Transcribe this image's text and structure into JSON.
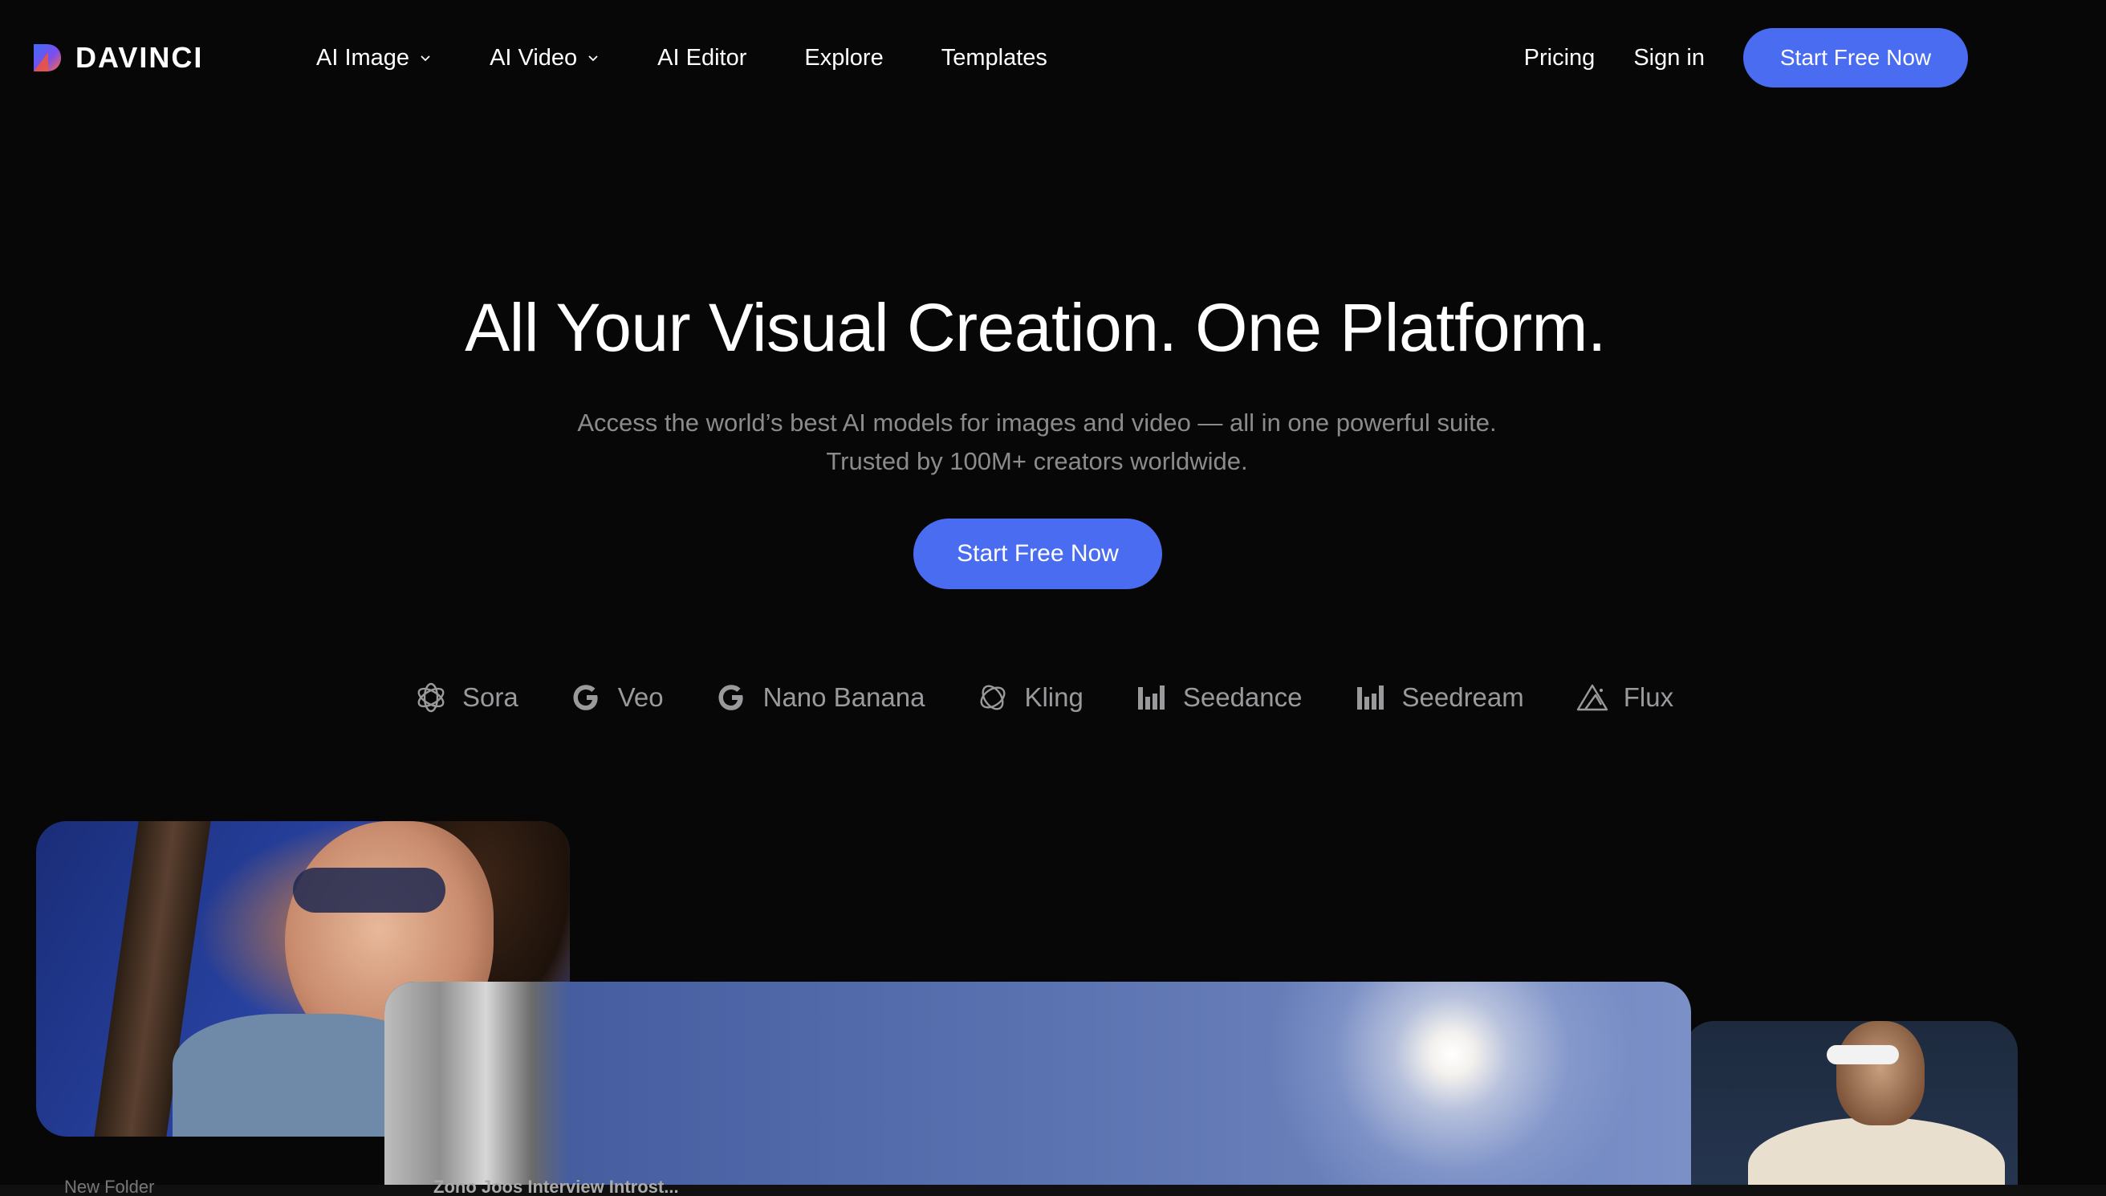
{
  "brand": {
    "name": "DAVINCI",
    "accent": "#4a6cf0"
  },
  "nav": {
    "items": [
      {
        "label": "AI Image",
        "has_dropdown": true
      },
      {
        "label": "AI Video",
        "has_dropdown": true
      },
      {
        "label": "AI Editor",
        "has_dropdown": false
      },
      {
        "label": "Explore",
        "has_dropdown": false
      },
      {
        "label": "Templates",
        "has_dropdown": false
      }
    ],
    "pricing": "Pricing",
    "sign_in": "Sign in",
    "cta": "Start Free Now"
  },
  "hero": {
    "title": "All Your Visual Creation. One Platform.",
    "subtitle_line1": "Access the world’s best AI models for images and video — all in one powerful suite.",
    "subtitle_line2": "Trusted by 100M+ creators worldwide.",
    "cta": "Start Free Now"
  },
  "models": [
    {
      "label": "Sora",
      "icon": "openai-icon"
    },
    {
      "label": "Veo",
      "icon": "google-icon"
    },
    {
      "label": "Nano Banana",
      "icon": "google-icon"
    },
    {
      "label": "Kling",
      "icon": "kling-icon"
    },
    {
      "label": "Seedance",
      "icon": "bytedance-icon"
    },
    {
      "label": "Seedream",
      "icon": "bytedance-icon"
    },
    {
      "label": "Flux",
      "icon": "flux-icon"
    }
  ],
  "bottom_strip": {
    "left_text": "New Folder",
    "center_text": "Zono Joos Interview Introst..."
  }
}
